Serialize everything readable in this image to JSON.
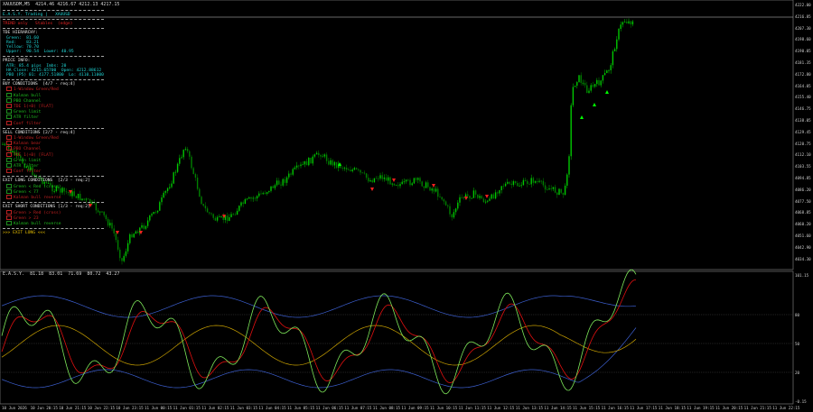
{
  "header": {
    "symbol_info": "XAUUSDM,M5  4214.46 4216.67 4212.13 4217.15",
    "indicator_info": "E.A.S.Y.  81.18  83.01  71.69  80.72  43.27"
  },
  "panel": {
    "title": "E.A.S.Y. Trading |   XAUUSD",
    "sub": "TREND only   Stables  (edge)",
    "tde_title": "TDE HIERARCHY:",
    "tde_lines": [
      "Green:  81.60",
      "Red:    83.21",
      "Yellow: 70.70",
      "Upper:  90.54  Lower: 40.95"
    ],
    "price_title": "PRICE INFO:",
    "price_lines": [
      "ATR: 85.4 pips  Imbs: 20",
      "HA Close: 4215.65700  Open: 4212.88612",
      "PBO (P5) 01: 4177.51800  Lo: 4110.11000"
    ],
    "buy_title": "BUY CONDITIONS  [4/7 - req:4]",
    "buy_items": [
      {
        "label": "1-Window Green/Red",
        "ok": false
      },
      {
        "label": "Kalman bull",
        "ok": true
      },
      {
        "label": "PBO Channel",
        "ok": true
      },
      {
        "label": "TDE 1(+B) [FLAT]",
        "ok": false
      },
      {
        "label": "Green limit",
        "ok": true
      },
      {
        "label": "ATR filter",
        "ok": true
      },
      {
        "label": "Conf filter",
        "ok": false
      }
    ],
    "sell_title": "SELL CONDITIONS [2/7 - req:4]",
    "sell_items": [
      {
        "label": "1-Window Green/Red",
        "ok": false
      },
      {
        "label": "Kalman bear",
        "ok": false
      },
      {
        "label": "PBO Channel",
        "ok": false
      },
      {
        "label": "TDE 1(+B) [FLAT]",
        "ok": false
      },
      {
        "label": "Green limit",
        "ok": true
      },
      {
        "label": "ATR filter",
        "ok": true
      },
      {
        "label": "Conf filter",
        "ok": false
      }
    ],
    "exit_long_title": "EXIT LONG CONDITIONS  [2/3 - req:2]",
    "exit_long_items": [
      {
        "label": "Green < Red (cross)",
        "ok": true
      },
      {
        "label": "Green < 77",
        "ok": true
      },
      {
        "label": "Kalman bull reverse",
        "ok": false
      }
    ],
    "exit_short_title": "EXIT SHORT CONDITIONS [1/3 - req:2]",
    "exit_short_items": [
      {
        "label": "Green > Red (cross)",
        "ok": false
      },
      {
        "label": "Green > 23",
        "ok": false
      },
      {
        "label": "Kalman bull reverse",
        "ok": true
      }
    ],
    "status": ">>> EXIT LONG <<<"
  },
  "price_axis": [
    "4222.00",
    "4216.85",
    "4207.30",
    "4198.60",
    "4190.05",
    "4181.35",
    "4172.80",
    "4164.05",
    "4155.40",
    "4146.75",
    "4138.05",
    "4129.45",
    "4120.75",
    "4112.10",
    "4103.55",
    "4094.85",
    "4086.20",
    "4077.50",
    "4068.85",
    "4060.20",
    "4051.60",
    "4042.90",
    "4034.30"
  ],
  "indicator_axis": [
    "101.15",
    "80",
    "50",
    "20",
    "-0.15"
  ],
  "time_axis": [
    "10 Jun 2026",
    "10 Jun 20:15",
    "10 Jun 21:15",
    "10 Jun 22:15",
    "10 Jun 23:15",
    "11 Jun 00:15",
    "11 Jun 01:15",
    "11 Jun 02:15",
    "11 Jun 03:15",
    "11 Jun 04:15",
    "11 Jun 05:15",
    "11 Jun 06:15",
    "11 Jun 07:15",
    "11 Jun 08:15",
    "11 Jun 09:15",
    "11 Jun 10:15",
    "11 Jun 11:15",
    "11 Jun 12:15",
    "11 Jun 13:15",
    "11 Jun 14:15",
    "11 Jun 15:15",
    "11 Jun 16:15",
    "11 Jun 17:15",
    "11 Jun 18:15",
    "11 Jun 19:15",
    "11 Jun 20:15",
    "11 Jun 21:15",
    "11 Jun 22:15"
  ],
  "colors": {
    "bull_candle": "#00c800",
    "bear_candle": "#008000",
    "green_line": "#7ee85a",
    "red_line": "#e01010",
    "yellow_line": "#c8a000",
    "band_line": "#3c5fd0",
    "buy_arrow": "#00ff00",
    "sell_arrow": "#ff2020"
  }
}
